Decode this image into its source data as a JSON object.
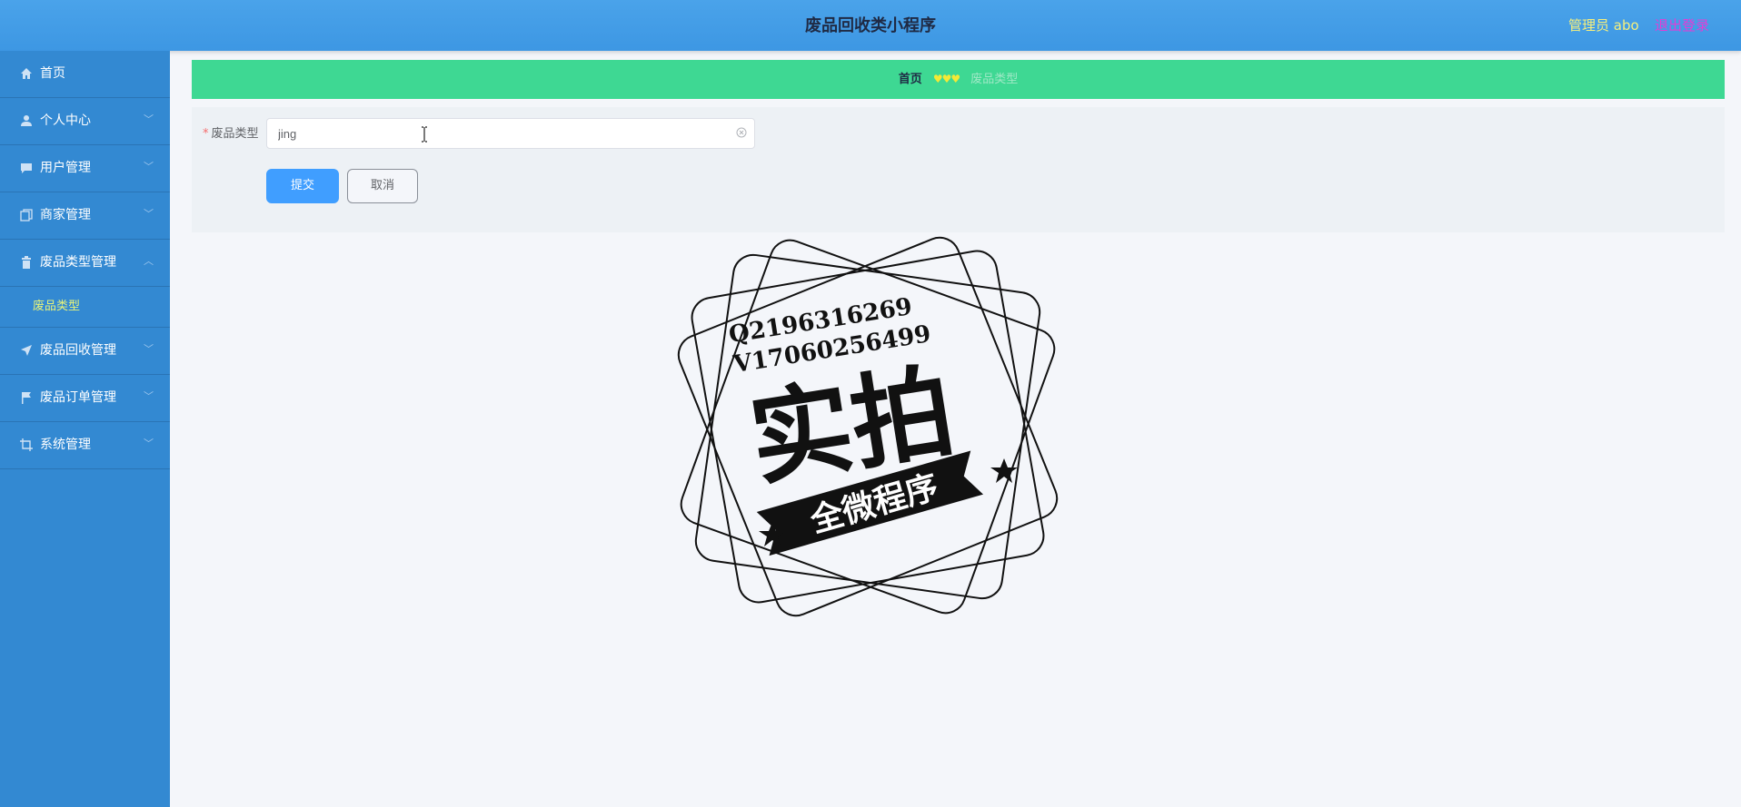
{
  "header": {
    "app_title": "废品回收类小程序",
    "admin_label": "管理员 abo",
    "logout_label": "退出登录"
  },
  "sidebar": {
    "items": [
      {
        "label": "首页",
        "icon": "home-icon"
      },
      {
        "label": "个人中心",
        "icon": "user-icon",
        "chevron": "down"
      },
      {
        "label": "用户管理",
        "icon": "chat-icon",
        "chevron": "down"
      },
      {
        "label": "商家管理",
        "icon": "copy-icon",
        "chevron": "down"
      },
      {
        "label": "废品类型管理",
        "icon": "trash-icon",
        "chevron": "up",
        "expanded": true,
        "children": [
          {
            "label": "废品类型",
            "active": true
          }
        ]
      },
      {
        "label": "废品回收管理",
        "icon": "send-icon",
        "chevron": "down"
      },
      {
        "label": "废品订单管理",
        "icon": "flag-icon",
        "chevron": "down"
      },
      {
        "label": "系统管理",
        "icon": "crop-icon",
        "chevron": "down"
      }
    ]
  },
  "breadcrumb": {
    "home": "首页",
    "separator": "♥♥♥",
    "current": "废品类型"
  },
  "form": {
    "field_label": "废品类型",
    "required_mark": "*",
    "field_value": "jing",
    "submit_label": "提交",
    "cancel_label": "取消"
  },
  "watermark": {
    "line1": "Q2196316269",
    "line2": "V17060256499",
    "big_text": "实拍",
    "banner_text": "全微程序"
  },
  "colors": {
    "header_bg": "#4aa3ea",
    "sidebar_bg": "#3389d2",
    "breadcrumb_bg": "#3ed893",
    "primary": "#409eff",
    "admin_text": "#f6ef7c",
    "logout_text": "#e23dd6",
    "active_submenu": "#e8f37a"
  }
}
